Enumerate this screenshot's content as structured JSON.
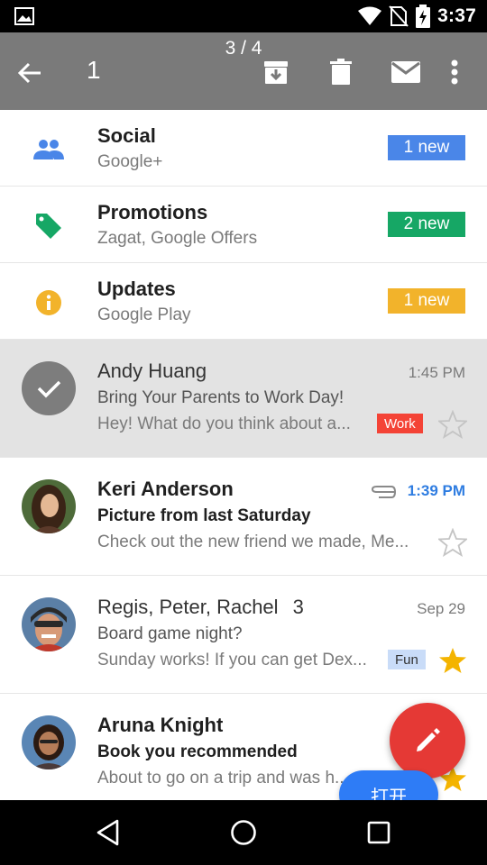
{
  "status_bar": {
    "time": "3:37",
    "icons": [
      "image-icon",
      "wifi-icon",
      "no-sim-icon",
      "battery-charging-icon"
    ]
  },
  "action_bar": {
    "counter": "3 / 4",
    "selected_count": "1",
    "actions": [
      "back-arrow-icon",
      "archive-icon",
      "delete-icon",
      "mark-unread-icon",
      "more-vert-icon"
    ]
  },
  "categories": [
    {
      "title": "Social",
      "subtitle": "Google+",
      "badge": "1 new",
      "color": "#4a86e8",
      "icon": "people-icon"
    },
    {
      "title": "Promotions",
      "subtitle": "Zagat, Google Offers",
      "badge": "2 new",
      "color": "#16a765",
      "icon": "tag-icon"
    },
    {
      "title": "Updates",
      "subtitle": "Google Play",
      "badge": "1 new",
      "color": "#f2b32b",
      "icon": "info-icon"
    }
  ],
  "emails": [
    {
      "sender": "Andy Huang",
      "time": "1:45 PM",
      "subject": "Bring Your Parents to Work Day!",
      "snippet": "Hey! What do you think about a...",
      "label": "Work",
      "starred": false,
      "selected": true
    },
    {
      "sender": "Keri Anderson",
      "time": "1:39 PM",
      "subject": "Picture from last Saturday",
      "snippet": "Check out the new friend we made, Me...",
      "starred": false,
      "unread": true,
      "attachment": true
    },
    {
      "sender": "Regis, Peter, Rachel",
      "count": "3",
      "time": "Sep 29",
      "subject": "Board game night?",
      "snippet": "Sunday works! If you can get Dex...",
      "label": "Fun",
      "starred": true
    },
    {
      "sender": "Aruna Knight",
      "subject": "Book you recommended",
      "snippet": "About to go on a trip and was h...",
      "starred": true,
      "unread": true
    }
  ],
  "fab": {
    "icon": "pencil-icon"
  },
  "open_button": {
    "label": "打开"
  },
  "nav_bar": {
    "icons": [
      "back-triangle-icon",
      "home-circle-icon",
      "recents-square-icon"
    ]
  },
  "colors": {
    "work_label": "#f44336",
    "fun_label": "#c9dcf8",
    "star": "#f4b400",
    "fab": "#e53935",
    "open_button": "#2e7cf6",
    "toolbar": "#7a7a7a"
  }
}
